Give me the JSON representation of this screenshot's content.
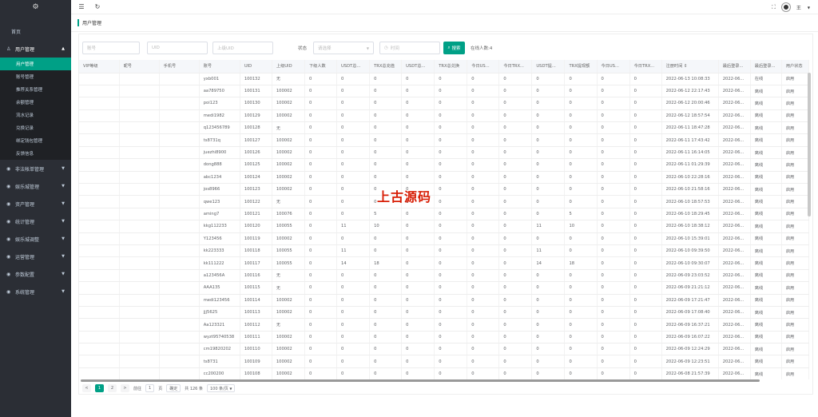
{
  "sidebar": {
    "logo_icon": "gear-icon",
    "home": "首页",
    "groups": [
      {
        "label": "用户管理",
        "icon": "user-icon",
        "expanded": true
      },
      {
        "label": "非法帐单管理",
        "icon": "circle-icon"
      },
      {
        "label": "娱乐城管理",
        "icon": "circle-icon"
      },
      {
        "label": "资产管理",
        "icon": "circle-icon"
      },
      {
        "label": "统计管理",
        "icon": "circle-icon"
      },
      {
        "label": "娱乐城调整",
        "icon": "circle-icon"
      },
      {
        "label": "运营管理",
        "icon": "circle-icon"
      },
      {
        "label": "参数配置",
        "icon": "circle-icon"
      },
      {
        "label": "系统管理",
        "icon": "circle-icon"
      }
    ],
    "sub_items": [
      "用户管理",
      "账号管理",
      "推荐关系管理",
      "余额管理",
      "流水记录",
      "兑换记录",
      "绑定钱包管理",
      "反馈信息"
    ]
  },
  "topbar": {
    "user": "王"
  },
  "page_title": "用户管理",
  "filters": {
    "account_placeholder": "账号",
    "uid_placeholder": "UID",
    "parent_uid_placeholder": "上级UID",
    "status_label": "状态",
    "status_placeholder": "请选择",
    "time_placeholder": "时间",
    "search_label": "搜索",
    "online_count": "在线人数:4"
  },
  "table": {
    "headers": [
      "VIP等级",
      "昵号",
      "手机号",
      "账号",
      "UID",
      "上级UID",
      "下级人数",
      "USDT总...",
      "TRX总充值",
      "USDT总...",
      "TRX总兑换",
      "今日US...",
      "今日TRX...",
      "USDT提...",
      "TRX提现额",
      "今日US...",
      "今日TRX...",
      "注册时间 ⇕",
      "最后登录...",
      "最后登录...",
      "用户状态"
    ],
    "rows": [
      [
        "",
        "",
        "",
        "yxb001",
        "100132",
        "无",
        "0",
        "0",
        "0",
        "0",
        "0",
        "0",
        "0",
        "0",
        "0",
        "0",
        "0",
        "2022-06-13 10:08:33",
        "2022-06...",
        "在线",
        "启用"
      ],
      [
        "",
        "",
        "",
        "aa789750",
        "100131",
        "100002",
        "0",
        "0",
        "0",
        "0",
        "0",
        "0",
        "0",
        "0",
        "0",
        "0",
        "0",
        "2022-06-12 22:17:43",
        "2022-06...",
        "离线",
        "启用"
      ],
      [
        "",
        "",
        "",
        "poi123",
        "100130",
        "100002",
        "0",
        "0",
        "0",
        "0",
        "0",
        "0",
        "0",
        "0",
        "0",
        "0",
        "0",
        "2022-06-12 20:00:46",
        "2022-06...",
        "离线",
        "启用"
      ],
      [
        "",
        "",
        "",
        "medi1982",
        "100129",
        "100002",
        "0",
        "0",
        "0",
        "0",
        "0",
        "0",
        "0",
        "0",
        "0",
        "0",
        "0",
        "2022-06-12 18:57:54",
        "2022-06...",
        "离线",
        "启用"
      ],
      [
        "",
        "",
        "",
        "q123456789",
        "100128",
        "无",
        "0",
        "0",
        "0",
        "0",
        "0",
        "0",
        "0",
        "0",
        "0",
        "0",
        "0",
        "2022-06-11 18:47:28",
        "2022-06...",
        "离线",
        "启用"
      ],
      [
        "",
        "",
        "",
        "ts8731q",
        "100127",
        "100002",
        "0",
        "0",
        "0",
        "0",
        "0",
        "0",
        "0",
        "0",
        "0",
        "0",
        "0",
        "2022-06-11 17:43:42",
        "2022-06...",
        "离线",
        "启用"
      ],
      [
        "",
        "",
        "",
        "juezhi8900",
        "100126",
        "100002",
        "0",
        "0",
        "0",
        "0",
        "0",
        "0",
        "0",
        "0",
        "0",
        "0",
        "0",
        "2022-06-11 16:14:05",
        "2022-06...",
        "离线",
        "启用"
      ],
      [
        "",
        "",
        "",
        "dong888",
        "100125",
        "100002",
        "0",
        "0",
        "0",
        "0",
        "0",
        "0",
        "0",
        "0",
        "0",
        "0",
        "0",
        "2022-06-11 01:29:39",
        "2022-06...",
        "离线",
        "启用"
      ],
      [
        "",
        "",
        "",
        "abc1234",
        "100124",
        "100002",
        "0",
        "0",
        "0",
        "0",
        "0",
        "0",
        "0",
        "0",
        "0",
        "0",
        "0",
        "2022-06-10 22:28:16",
        "2022-06...",
        "离线",
        "启用"
      ],
      [
        "",
        "",
        "",
        "jos8966",
        "100123",
        "100002",
        "0",
        "0",
        "0",
        "0",
        "0",
        "0",
        "0",
        "0",
        "0",
        "0",
        "0",
        "2022-06-10 21:58:16",
        "2022-06...",
        "离线",
        "启用"
      ],
      [
        "",
        "",
        "",
        "qwe123",
        "100122",
        "无",
        "0",
        "0",
        "0",
        "0",
        "0",
        "0",
        "0",
        "0",
        "0",
        "0",
        "0",
        "2022-06-10 18:57:53",
        "2022-06...",
        "离线",
        "启用"
      ],
      [
        "",
        "",
        "",
        "aming7",
        "100121",
        "100076",
        "0",
        "0",
        "5",
        "0",
        "0",
        "0",
        "0",
        "0",
        "5",
        "0",
        "0",
        "2022-06-10 18:29:45",
        "2022-06...",
        "离线",
        "启用"
      ],
      [
        "",
        "",
        "",
        "kkg112233",
        "100120",
        "100055",
        "0",
        "11",
        "10",
        "0",
        "0",
        "0",
        "0",
        "11",
        "10",
        "0",
        "0",
        "2022-06-10 18:38:12",
        "2022-06...",
        "离线",
        "启用"
      ],
      [
        "",
        "",
        "",
        "Y123456",
        "100119",
        "100002",
        "0",
        "0",
        "0",
        "0",
        "0",
        "0",
        "0",
        "0",
        "0",
        "0",
        "0",
        "2022-06-10 15:39:01",
        "2022-06...",
        "离线",
        "启用"
      ],
      [
        "",
        "",
        "",
        "kk223333",
        "100118",
        "100055",
        "0",
        "11",
        "0",
        "0",
        "0",
        "0",
        "0",
        "11",
        "0",
        "0",
        "0",
        "2022-06-10 09:39:50",
        "2022-06...",
        "离线",
        "启用"
      ],
      [
        "",
        "",
        "",
        "kk111222",
        "100117",
        "100055",
        "0",
        "14",
        "18",
        "0",
        "0",
        "0",
        "0",
        "14",
        "18",
        "0",
        "0",
        "2022-06-10 09:30:07",
        "2022-06...",
        "离线",
        "启用"
      ],
      [
        "",
        "",
        "",
        "a123456A",
        "100116",
        "无",
        "0",
        "0",
        "0",
        "0",
        "0",
        "0",
        "0",
        "0",
        "0",
        "0",
        "0",
        "2022-06-09 23:03:52",
        "2022-06...",
        "离线",
        "启用"
      ],
      [
        "",
        "",
        "",
        "AAA135",
        "100115",
        "无",
        "0",
        "0",
        "0",
        "0",
        "0",
        "0",
        "0",
        "0",
        "0",
        "0",
        "0",
        "2022-06-09 21:21:12",
        "2022-06...",
        "离线",
        "启用"
      ],
      [
        "",
        "",
        "",
        "medi123456",
        "100114",
        "100002",
        "0",
        "0",
        "0",
        "0",
        "0",
        "0",
        "0",
        "0",
        "0",
        "0",
        "0",
        "2022-06-09 17:21:47",
        "2022-06...",
        "离线",
        "启用"
      ],
      [
        "",
        "",
        "",
        "jjj5625",
        "100113",
        "100002",
        "0",
        "0",
        "0",
        "0",
        "0",
        "0",
        "0",
        "0",
        "0",
        "0",
        "0",
        "2022-06-09 17:08:40",
        "2022-06...",
        "离线",
        "启用"
      ],
      [
        "",
        "",
        "",
        "Aa123321",
        "100112",
        "无",
        "0",
        "0",
        "0",
        "0",
        "0",
        "0",
        "0",
        "0",
        "0",
        "0",
        "0",
        "2022-06-09 16:37:21",
        "2022-06...",
        "离线",
        "启用"
      ],
      [
        "",
        "",
        "",
        "wyzt95740538",
        "100111",
        "100002",
        "0",
        "0",
        "0",
        "0",
        "0",
        "0",
        "0",
        "0",
        "0",
        "0",
        "0",
        "2022-06-09 16:07:22",
        "2022-06...",
        "离线",
        "启用"
      ],
      [
        "",
        "",
        "",
        "cm19820202",
        "100110",
        "100002",
        "0",
        "0",
        "0",
        "0",
        "0",
        "0",
        "0",
        "0",
        "0",
        "0",
        "0",
        "2022-06-09 12:24:29",
        "2022-06...",
        "离线",
        "启用"
      ],
      [
        "",
        "",
        "",
        "ts8731",
        "100109",
        "100002",
        "0",
        "0",
        "0",
        "0",
        "0",
        "0",
        "0",
        "0",
        "0",
        "0",
        "0",
        "2022-06-09 12:23:51",
        "2022-06...",
        "离线",
        "启用"
      ],
      [
        "",
        "",
        "",
        "cc200200",
        "100108",
        "100002",
        "0",
        "0",
        "0",
        "0",
        "0",
        "0",
        "0",
        "0",
        "0",
        "0",
        "0",
        "2022-06-08 21:57:39",
        "2022-06...",
        "离线",
        "启用"
      ]
    ]
  },
  "pager": {
    "prev": "<",
    "pages": [
      "1",
      "2"
    ],
    "next": ">",
    "goto_label": "前往",
    "goto_value": "1",
    "page_unit": "页",
    "confirm": "确定",
    "total": "共 126 条",
    "page_size": "100 条/页"
  },
  "watermark": "上古源码",
  "colors": {
    "accent": "#00a086",
    "sidebar": "#2b2e35",
    "watermark": "#d81e06"
  }
}
